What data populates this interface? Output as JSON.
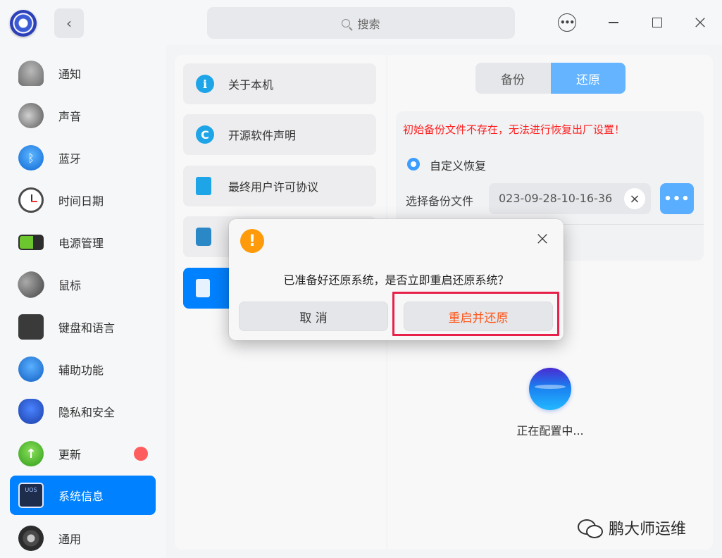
{
  "titlebar": {
    "back_icon": "chevron-left-icon",
    "search_placeholder": "搜索",
    "menu_icon": "more-horizontal-icon",
    "close_glyph": "×"
  },
  "sidebar": {
    "items": [
      {
        "label": "通知",
        "icon": "bell-icon"
      },
      {
        "label": "声音",
        "icon": "speaker-icon"
      },
      {
        "label": "蓝牙",
        "icon": "bluetooth-icon"
      },
      {
        "label": "时间日期",
        "icon": "clock-icon"
      },
      {
        "label": "电源管理",
        "icon": "battery-icon"
      },
      {
        "label": "鼠标",
        "icon": "mouse-icon"
      },
      {
        "label": "键盘和语言",
        "icon": "keyboard-icon"
      },
      {
        "label": "辅助功能",
        "icon": "accessibility-icon"
      },
      {
        "label": "隐私和安全",
        "icon": "shield-hand-icon"
      },
      {
        "label": "更新",
        "icon": "update-arrow-icon",
        "badge": true
      },
      {
        "label": "系统信息",
        "icon": "system-info-icon",
        "active": true
      },
      {
        "label": "通用",
        "icon": "gear-icon"
      }
    ]
  },
  "middle": {
    "items": [
      {
        "label": "关于本机",
        "icon": "info-icon",
        "glyph": "i"
      },
      {
        "label": "开源软件声明",
        "icon": "copyright-icon",
        "glyph": "C"
      },
      {
        "label": "最终用户许可协议",
        "icon": "document-list-icon"
      },
      {
        "label": "",
        "icon": "edition-badge-icon"
      },
      {
        "label": "",
        "icon": "backup-restore-icon",
        "active": true
      }
    ]
  },
  "right": {
    "tabs": [
      {
        "label": "备份",
        "active": false
      },
      {
        "label": "还原",
        "active": true
      }
    ],
    "warning": "初始备份文件不存在，无法进行恢复出厂设置！",
    "custom_restore_label": "自定义恢复",
    "file_label": "选择备份文件",
    "file_value": "023-09-28-10-16-36",
    "clear_glyph": "×",
    "browse_glyph": "•••",
    "progress_text": "正在配置中..."
  },
  "dialog": {
    "warn_glyph": "!",
    "close_glyph": "×",
    "message": "已准备好还原系统，是否立即重启还原系统？",
    "cancel_label": "取 消",
    "restart_label": "重启并还原"
  },
  "watermark": {
    "text": "鹏大师运维"
  },
  "colors": {
    "accent": "#0081ff",
    "warning_text": "#ff1f1f",
    "restart_text": "#ff5316",
    "highlight": "#e8214a",
    "badge": "#ff5d5d"
  }
}
